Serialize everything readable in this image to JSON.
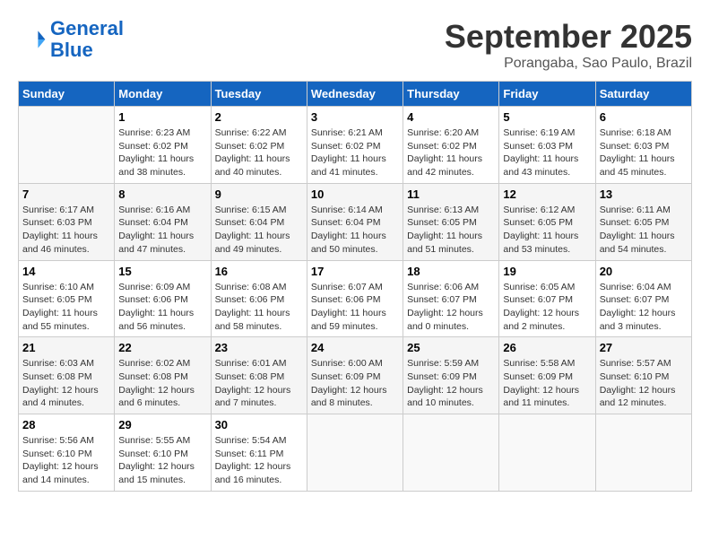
{
  "header": {
    "logo_line1": "General",
    "logo_line2": "Blue",
    "month": "September 2025",
    "location": "Porangaba, Sao Paulo, Brazil"
  },
  "days_of_week": [
    "Sunday",
    "Monday",
    "Tuesday",
    "Wednesday",
    "Thursday",
    "Friday",
    "Saturday"
  ],
  "weeks": [
    [
      {
        "day": "",
        "info": ""
      },
      {
        "day": "1",
        "info": "Sunrise: 6:23 AM\nSunset: 6:02 PM\nDaylight: 11 hours\nand 38 minutes."
      },
      {
        "day": "2",
        "info": "Sunrise: 6:22 AM\nSunset: 6:02 PM\nDaylight: 11 hours\nand 40 minutes."
      },
      {
        "day": "3",
        "info": "Sunrise: 6:21 AM\nSunset: 6:02 PM\nDaylight: 11 hours\nand 41 minutes."
      },
      {
        "day": "4",
        "info": "Sunrise: 6:20 AM\nSunset: 6:02 PM\nDaylight: 11 hours\nand 42 minutes."
      },
      {
        "day": "5",
        "info": "Sunrise: 6:19 AM\nSunset: 6:03 PM\nDaylight: 11 hours\nand 43 minutes."
      },
      {
        "day": "6",
        "info": "Sunrise: 6:18 AM\nSunset: 6:03 PM\nDaylight: 11 hours\nand 45 minutes."
      }
    ],
    [
      {
        "day": "7",
        "info": "Sunrise: 6:17 AM\nSunset: 6:03 PM\nDaylight: 11 hours\nand 46 minutes."
      },
      {
        "day": "8",
        "info": "Sunrise: 6:16 AM\nSunset: 6:04 PM\nDaylight: 11 hours\nand 47 minutes."
      },
      {
        "day": "9",
        "info": "Sunrise: 6:15 AM\nSunset: 6:04 PM\nDaylight: 11 hours\nand 49 minutes."
      },
      {
        "day": "10",
        "info": "Sunrise: 6:14 AM\nSunset: 6:04 PM\nDaylight: 11 hours\nand 50 minutes."
      },
      {
        "day": "11",
        "info": "Sunrise: 6:13 AM\nSunset: 6:05 PM\nDaylight: 11 hours\nand 51 minutes."
      },
      {
        "day": "12",
        "info": "Sunrise: 6:12 AM\nSunset: 6:05 PM\nDaylight: 11 hours\nand 53 minutes."
      },
      {
        "day": "13",
        "info": "Sunrise: 6:11 AM\nSunset: 6:05 PM\nDaylight: 11 hours\nand 54 minutes."
      }
    ],
    [
      {
        "day": "14",
        "info": "Sunrise: 6:10 AM\nSunset: 6:05 PM\nDaylight: 11 hours\nand 55 minutes."
      },
      {
        "day": "15",
        "info": "Sunrise: 6:09 AM\nSunset: 6:06 PM\nDaylight: 11 hours\nand 56 minutes."
      },
      {
        "day": "16",
        "info": "Sunrise: 6:08 AM\nSunset: 6:06 PM\nDaylight: 11 hours\nand 58 minutes."
      },
      {
        "day": "17",
        "info": "Sunrise: 6:07 AM\nSunset: 6:06 PM\nDaylight: 11 hours\nand 59 minutes."
      },
      {
        "day": "18",
        "info": "Sunrise: 6:06 AM\nSunset: 6:07 PM\nDaylight: 12 hours\nand 0 minutes."
      },
      {
        "day": "19",
        "info": "Sunrise: 6:05 AM\nSunset: 6:07 PM\nDaylight: 12 hours\nand 2 minutes."
      },
      {
        "day": "20",
        "info": "Sunrise: 6:04 AM\nSunset: 6:07 PM\nDaylight: 12 hours\nand 3 minutes."
      }
    ],
    [
      {
        "day": "21",
        "info": "Sunrise: 6:03 AM\nSunset: 6:08 PM\nDaylight: 12 hours\nand 4 minutes."
      },
      {
        "day": "22",
        "info": "Sunrise: 6:02 AM\nSunset: 6:08 PM\nDaylight: 12 hours\nand 6 minutes."
      },
      {
        "day": "23",
        "info": "Sunrise: 6:01 AM\nSunset: 6:08 PM\nDaylight: 12 hours\nand 7 minutes."
      },
      {
        "day": "24",
        "info": "Sunrise: 6:00 AM\nSunset: 6:09 PM\nDaylight: 12 hours\nand 8 minutes."
      },
      {
        "day": "25",
        "info": "Sunrise: 5:59 AM\nSunset: 6:09 PM\nDaylight: 12 hours\nand 10 minutes."
      },
      {
        "day": "26",
        "info": "Sunrise: 5:58 AM\nSunset: 6:09 PM\nDaylight: 12 hours\nand 11 minutes."
      },
      {
        "day": "27",
        "info": "Sunrise: 5:57 AM\nSunset: 6:10 PM\nDaylight: 12 hours\nand 12 minutes."
      }
    ],
    [
      {
        "day": "28",
        "info": "Sunrise: 5:56 AM\nSunset: 6:10 PM\nDaylight: 12 hours\nand 14 minutes."
      },
      {
        "day": "29",
        "info": "Sunrise: 5:55 AM\nSunset: 6:10 PM\nDaylight: 12 hours\nand 15 minutes."
      },
      {
        "day": "30",
        "info": "Sunrise: 5:54 AM\nSunset: 6:11 PM\nDaylight: 12 hours\nand 16 minutes."
      },
      {
        "day": "",
        "info": ""
      },
      {
        "day": "",
        "info": ""
      },
      {
        "day": "",
        "info": ""
      },
      {
        "day": "",
        "info": ""
      }
    ]
  ]
}
